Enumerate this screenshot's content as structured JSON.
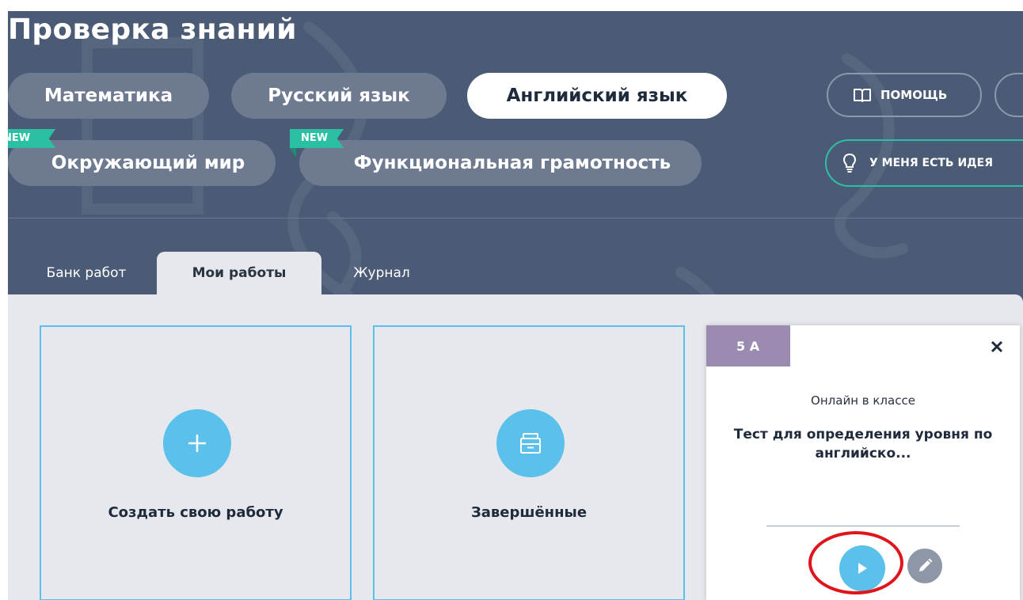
{
  "header": {
    "title": "Проверка знаний"
  },
  "subjects": {
    "math": "Математика",
    "russian": "Русский язык",
    "english": "Английский язык",
    "world": "Окружающий мир",
    "literacy": "Функциональная грамотность",
    "new_badge": "NEW",
    "active": "Английский язык"
  },
  "actions": {
    "help": "ПОМОЩЬ",
    "idea": "У МЕНЯ ЕСТЬ ИДЕЯ"
  },
  "tabs": {
    "bank": "Банк работ",
    "mine": "Мои работы",
    "journal": "Журнал",
    "active": "Мои работы"
  },
  "cards": {
    "create": "Создать свою работу",
    "completed": "Завершённые"
  },
  "work": {
    "class": "5 А",
    "type": "Онлайн в классе",
    "title": "Тест для определения уровня по английско..."
  },
  "icons": {
    "help": "book-icon",
    "idea": "lightbulb-icon",
    "close": "close-icon",
    "create": "plus-icon",
    "completed": "archive-box-icon",
    "play": "play-icon",
    "edit": "pencil-icon"
  },
  "colors": {
    "background": "#4b5b75",
    "content": "#e6e8ee",
    "accent_blue": "#5bc0ea",
    "accent_green": "#2bc0a4",
    "class_badge": "#9b8bb0",
    "highlight": "#e0141b"
  }
}
